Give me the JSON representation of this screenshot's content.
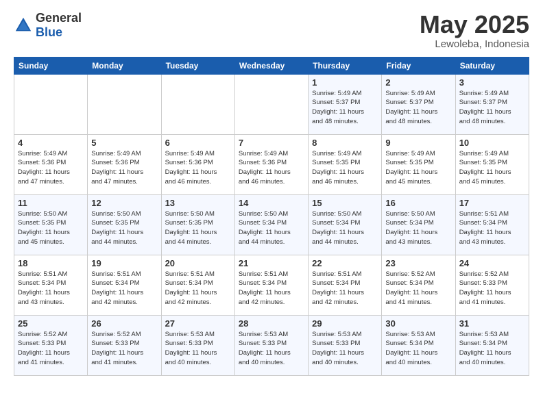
{
  "header": {
    "logo_general": "General",
    "logo_blue": "Blue",
    "month": "May 2025",
    "location": "Lewoleba, Indonesia"
  },
  "weekdays": [
    "Sunday",
    "Monday",
    "Tuesday",
    "Wednesday",
    "Thursday",
    "Friday",
    "Saturday"
  ],
  "rows": [
    [
      {
        "day": "",
        "detail": ""
      },
      {
        "day": "",
        "detail": ""
      },
      {
        "day": "",
        "detail": ""
      },
      {
        "day": "",
        "detail": ""
      },
      {
        "day": "1",
        "detail": "Sunrise: 5:49 AM\nSunset: 5:37 PM\nDaylight: 11 hours\nand 48 minutes."
      },
      {
        "day": "2",
        "detail": "Sunrise: 5:49 AM\nSunset: 5:37 PM\nDaylight: 11 hours\nand 48 minutes."
      },
      {
        "day": "3",
        "detail": "Sunrise: 5:49 AM\nSunset: 5:37 PM\nDaylight: 11 hours\nand 48 minutes."
      }
    ],
    [
      {
        "day": "4",
        "detail": "Sunrise: 5:49 AM\nSunset: 5:36 PM\nDaylight: 11 hours\nand 47 minutes."
      },
      {
        "day": "5",
        "detail": "Sunrise: 5:49 AM\nSunset: 5:36 PM\nDaylight: 11 hours\nand 47 minutes."
      },
      {
        "day": "6",
        "detail": "Sunrise: 5:49 AM\nSunset: 5:36 PM\nDaylight: 11 hours\nand 46 minutes."
      },
      {
        "day": "7",
        "detail": "Sunrise: 5:49 AM\nSunset: 5:36 PM\nDaylight: 11 hours\nand 46 minutes."
      },
      {
        "day": "8",
        "detail": "Sunrise: 5:49 AM\nSunset: 5:35 PM\nDaylight: 11 hours\nand 46 minutes."
      },
      {
        "day": "9",
        "detail": "Sunrise: 5:49 AM\nSunset: 5:35 PM\nDaylight: 11 hours\nand 45 minutes."
      },
      {
        "day": "10",
        "detail": "Sunrise: 5:49 AM\nSunset: 5:35 PM\nDaylight: 11 hours\nand 45 minutes."
      }
    ],
    [
      {
        "day": "11",
        "detail": "Sunrise: 5:50 AM\nSunset: 5:35 PM\nDaylight: 11 hours\nand 45 minutes."
      },
      {
        "day": "12",
        "detail": "Sunrise: 5:50 AM\nSunset: 5:35 PM\nDaylight: 11 hours\nand 44 minutes."
      },
      {
        "day": "13",
        "detail": "Sunrise: 5:50 AM\nSunset: 5:35 PM\nDaylight: 11 hours\nand 44 minutes."
      },
      {
        "day": "14",
        "detail": "Sunrise: 5:50 AM\nSunset: 5:34 PM\nDaylight: 11 hours\nand 44 minutes."
      },
      {
        "day": "15",
        "detail": "Sunrise: 5:50 AM\nSunset: 5:34 PM\nDaylight: 11 hours\nand 44 minutes."
      },
      {
        "day": "16",
        "detail": "Sunrise: 5:50 AM\nSunset: 5:34 PM\nDaylight: 11 hours\nand 43 minutes."
      },
      {
        "day": "17",
        "detail": "Sunrise: 5:51 AM\nSunset: 5:34 PM\nDaylight: 11 hours\nand 43 minutes."
      }
    ],
    [
      {
        "day": "18",
        "detail": "Sunrise: 5:51 AM\nSunset: 5:34 PM\nDaylight: 11 hours\nand 43 minutes."
      },
      {
        "day": "19",
        "detail": "Sunrise: 5:51 AM\nSunset: 5:34 PM\nDaylight: 11 hours\nand 42 minutes."
      },
      {
        "day": "20",
        "detail": "Sunrise: 5:51 AM\nSunset: 5:34 PM\nDaylight: 11 hours\nand 42 minutes."
      },
      {
        "day": "21",
        "detail": "Sunrise: 5:51 AM\nSunset: 5:34 PM\nDaylight: 11 hours\nand 42 minutes."
      },
      {
        "day": "22",
        "detail": "Sunrise: 5:51 AM\nSunset: 5:34 PM\nDaylight: 11 hours\nand 42 minutes."
      },
      {
        "day": "23",
        "detail": "Sunrise: 5:52 AM\nSunset: 5:34 PM\nDaylight: 11 hours\nand 41 minutes."
      },
      {
        "day": "24",
        "detail": "Sunrise: 5:52 AM\nSunset: 5:33 PM\nDaylight: 11 hours\nand 41 minutes."
      }
    ],
    [
      {
        "day": "25",
        "detail": "Sunrise: 5:52 AM\nSunset: 5:33 PM\nDaylight: 11 hours\nand 41 minutes."
      },
      {
        "day": "26",
        "detail": "Sunrise: 5:52 AM\nSunset: 5:33 PM\nDaylight: 11 hours\nand 41 minutes."
      },
      {
        "day": "27",
        "detail": "Sunrise: 5:53 AM\nSunset: 5:33 PM\nDaylight: 11 hours\nand 40 minutes."
      },
      {
        "day": "28",
        "detail": "Sunrise: 5:53 AM\nSunset: 5:33 PM\nDaylight: 11 hours\nand 40 minutes."
      },
      {
        "day": "29",
        "detail": "Sunrise: 5:53 AM\nSunset: 5:33 PM\nDaylight: 11 hours\nand 40 minutes."
      },
      {
        "day": "30",
        "detail": "Sunrise: 5:53 AM\nSunset: 5:34 PM\nDaylight: 11 hours\nand 40 minutes."
      },
      {
        "day": "31",
        "detail": "Sunrise: 5:53 AM\nSunset: 5:34 PM\nDaylight: 11 hours\nand 40 minutes."
      }
    ]
  ]
}
